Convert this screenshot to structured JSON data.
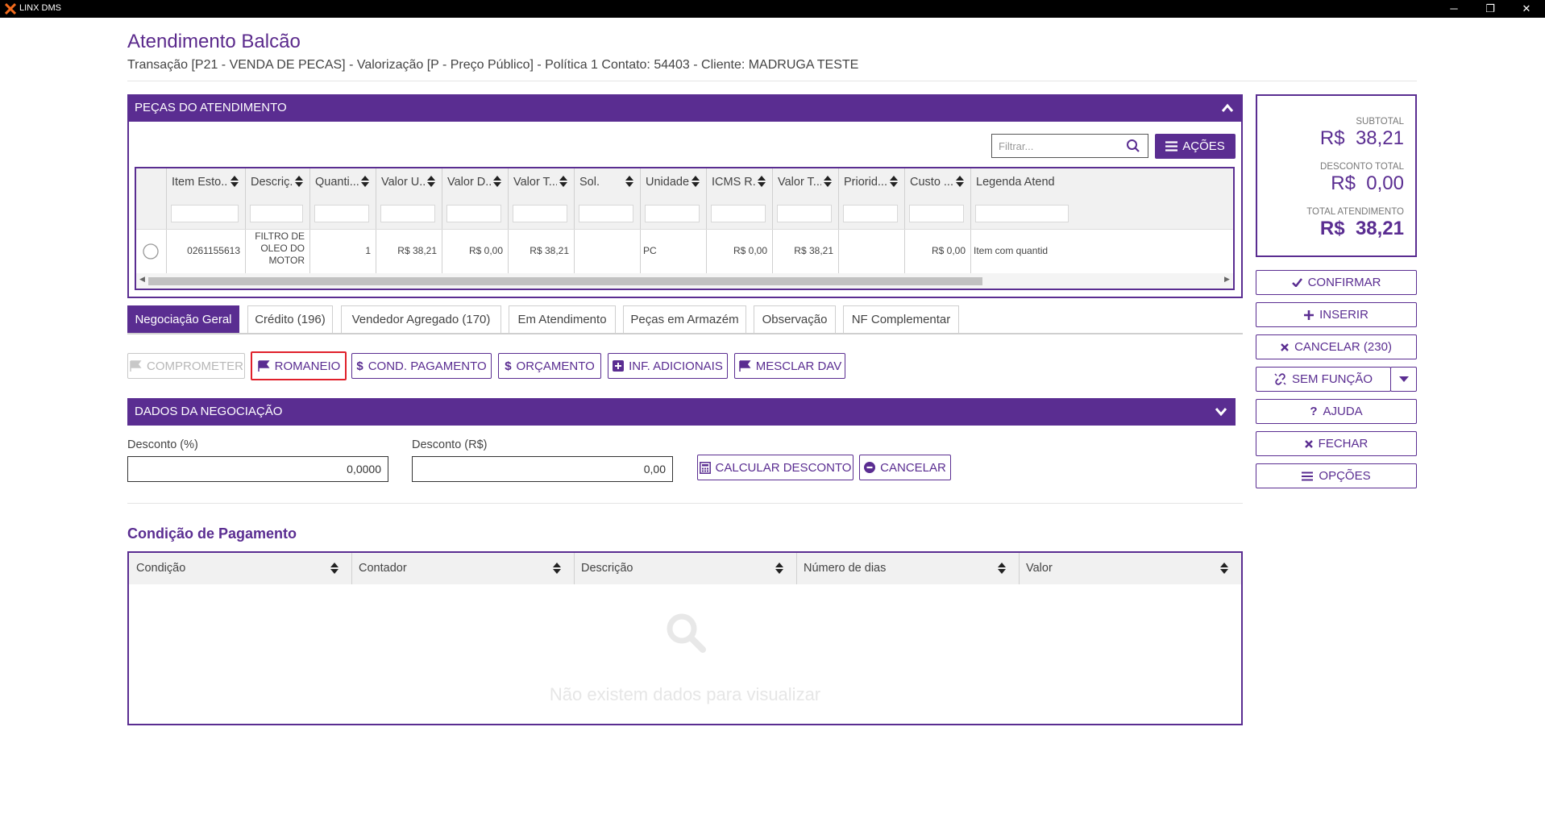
{
  "window": {
    "title": "LINX DMS",
    "minimize": "─",
    "restore": "❐",
    "close": "✕"
  },
  "header": {
    "title": "Atendimento Balcão",
    "subtitle": "Transação [P21 - VENDA DE PECAS] - Valorização [P - Preço Público] - Política 1 Contato: 54403 - Cliente: MADRUGA TESTE"
  },
  "parts_panel": {
    "title": "PEÇAS DO ATENDIMENTO",
    "filter_placeholder": "Filtrar...",
    "actions_label": "AÇÕES",
    "columns": [
      "Item Esto...",
      "Descriç...",
      "Quanti...",
      "Valor U...",
      "Valor D...",
      "Valor T...",
      "Sol.",
      "Unidade",
      "ICMS R...",
      "Valor T...",
      "Priorid...",
      "Custo ...",
      "Legenda Atend"
    ],
    "rows": [
      {
        "item": "0261155613",
        "description_lines": [
          "FILTRO DE",
          "OLEO DO",
          "MOTOR"
        ],
        "quantity": "1",
        "unit_value": "R$ 38,21",
        "discount_value": "R$ 0,00",
        "total_value": "R$ 38,21",
        "sol": "",
        "unit": "PC",
        "icms": "R$ 0,00",
        "total2": "R$ 38,21",
        "priority": "",
        "cost": "R$ 0,00",
        "legend": "Item com quantid"
      }
    ]
  },
  "tabs": [
    {
      "label": "Negociação Geral",
      "active": true
    },
    {
      "label": "Crédito (196)",
      "active": false
    },
    {
      "label": "Vendedor Agregado (170)",
      "active": false
    },
    {
      "label": "Em Atendimento",
      "active": false
    },
    {
      "label": "Peças em Armazém",
      "active": false
    },
    {
      "label": "Observação",
      "active": false
    },
    {
      "label": "NF Complementar",
      "active": false
    }
  ],
  "toolbar": {
    "comprometer": "COMPROMETER",
    "romaneio": "ROMANEIO",
    "cond_pagamento": "COND. PAGAMENTO",
    "orcamento": "ORÇAMENTO",
    "inf_adicionais": "INF. ADICIONAIS",
    "mesclar_dav": "MESCLAR DAV"
  },
  "negotiation": {
    "title": "DADOS DA NEGOCIAÇÃO",
    "discount_pct_label": "Desconto (%)",
    "discount_pct_value": "0,0000",
    "discount_rs_label": "Desconto (R$)",
    "discount_rs_value": "0,00",
    "calc_label": "CALCULAR DESCONTO",
    "cancel_label": "CANCELAR"
  },
  "payment": {
    "title": "Condição de Pagamento",
    "columns": [
      "Condição",
      "Contador",
      "Descrição",
      "Número de dias",
      "Valor"
    ],
    "empty_text": "Não existem dados para visualizar"
  },
  "summary": {
    "subtotal_label": "SUBTOTAL",
    "subtotal_value": "R$  38,21",
    "discount_label": "DESCONTO TOTAL",
    "discount_value": "R$  0,00",
    "total_label": "TOTAL ATENDIMENTO",
    "total_value": "R$  38,21"
  },
  "right_actions": {
    "confirmar": "CONFIRMAR",
    "inserir": "INSERIR",
    "cancelar": "CANCELAR (230)",
    "sem_funcao": "SEM FUNÇÃO",
    "ajuda": "AJUDA",
    "fechar": "FECHAR",
    "opcoes": "OPÇÕES"
  },
  "colors": {
    "brand_purple": "#5a2d91",
    "title_purple": "#5b2a8c",
    "selected_border": "#e0202a"
  }
}
